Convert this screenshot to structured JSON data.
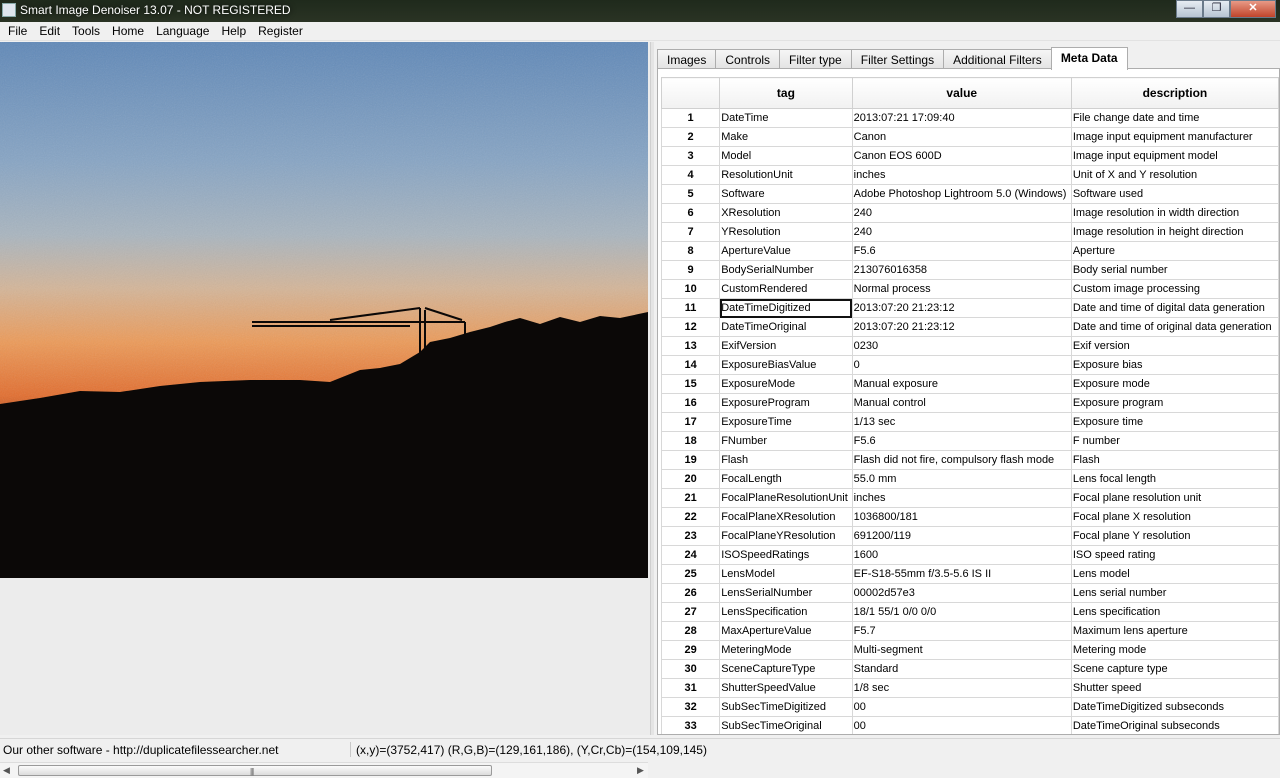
{
  "window": {
    "title": "Smart Image Denoiser 13.07 - NOT REGISTERED",
    "minimize_label": "—",
    "maximize_label": "❐",
    "close_label": "✕"
  },
  "menu": [
    "File",
    "Edit",
    "Tools",
    "Home",
    "Language",
    "Help",
    "Register"
  ],
  "tabs": [
    {
      "label": "Images",
      "active": false
    },
    {
      "label": "Controls",
      "active": false
    },
    {
      "label": "Filter type",
      "active": false
    },
    {
      "label": "Filter Settings",
      "active": false
    },
    {
      "label": "Additional Filters",
      "active": false
    },
    {
      "label": "Meta Data",
      "active": true
    }
  ],
  "table": {
    "headers": [
      "",
      "tag",
      "value",
      "description"
    ],
    "selected_row": 11,
    "rows": [
      {
        "n": "1",
        "tag": "DateTime",
        "value": "2013:07:21 17:09:40",
        "desc": "File change date and time"
      },
      {
        "n": "2",
        "tag": "Make",
        "value": "Canon",
        "desc": "Image input equipment manufacturer"
      },
      {
        "n": "3",
        "tag": "Model",
        "value": "Canon EOS 600D",
        "desc": "Image input equipment model"
      },
      {
        "n": "4",
        "tag": "ResolutionUnit",
        "value": "inches",
        "desc": "Unit of X and Y resolution"
      },
      {
        "n": "5",
        "tag": "Software",
        "value": "Adobe Photoshop Lightroom 5.0 (Windows)",
        "desc": "Software used"
      },
      {
        "n": "6",
        "tag": "XResolution",
        "value": "240",
        "desc": "Image resolution in width direction"
      },
      {
        "n": "7",
        "tag": "YResolution",
        "value": "240",
        "desc": "Image resolution in height direction"
      },
      {
        "n": "8",
        "tag": "ApertureValue",
        "value": "F5.6",
        "desc": "Aperture"
      },
      {
        "n": "9",
        "tag": "BodySerialNumber",
        "value": "213076016358",
        "desc": "Body serial number"
      },
      {
        "n": "10",
        "tag": "CustomRendered",
        "value": "Normal process",
        "desc": "Custom image processing"
      },
      {
        "n": "11",
        "tag": "DateTimeDigitized",
        "value": "2013:07:20 21:23:12",
        "desc": "Date and time of digital data generation"
      },
      {
        "n": "12",
        "tag": "DateTimeOriginal",
        "value": "2013:07:20 21:23:12",
        "desc": "Date and time of original data generation"
      },
      {
        "n": "13",
        "tag": "ExifVersion",
        "value": "0230",
        "desc": "Exif version"
      },
      {
        "n": "14",
        "tag": "ExposureBiasValue",
        "value": "0",
        "desc": "Exposure bias"
      },
      {
        "n": "15",
        "tag": "ExposureMode",
        "value": "Manual exposure",
        "desc": "Exposure mode"
      },
      {
        "n": "16",
        "tag": "ExposureProgram",
        "value": "Manual control",
        "desc": "Exposure program"
      },
      {
        "n": "17",
        "tag": "ExposureTime",
        "value": "1/13 sec",
        "desc": "Exposure time"
      },
      {
        "n": "18",
        "tag": "FNumber",
        "value": "F5.6",
        "desc": "F number"
      },
      {
        "n": "19",
        "tag": "Flash",
        "value": "Flash did not fire, compulsory flash mode",
        "desc": "Flash"
      },
      {
        "n": "20",
        "tag": "FocalLength",
        "value": "55.0 mm",
        "desc": "Lens focal length"
      },
      {
        "n": "21",
        "tag": "FocalPlaneResolutionUnit",
        "value": "inches",
        "desc": "Focal plane resolution unit"
      },
      {
        "n": "22",
        "tag": "FocalPlaneXResolution",
        "value": "1036800/181",
        "desc": "Focal plane X resolution"
      },
      {
        "n": "23",
        "tag": "FocalPlaneYResolution",
        "value": "691200/119",
        "desc": "Focal plane Y resolution"
      },
      {
        "n": "24",
        "tag": "ISOSpeedRatings",
        "value": "1600",
        "desc": "ISO speed rating"
      },
      {
        "n": "25",
        "tag": "LensModel",
        "value": "EF-S18-55mm f/3.5-5.6 IS II",
        "desc": "Lens model"
      },
      {
        "n": "26",
        "tag": "LensSerialNumber",
        "value": "00002d57e3",
        "desc": "Lens serial number"
      },
      {
        "n": "27",
        "tag": "LensSpecification",
        "value": "18/1 55/1 0/0 0/0",
        "desc": "Lens specification"
      },
      {
        "n": "28",
        "tag": "MaxApertureValue",
        "value": "F5.7",
        "desc": "Maximum lens aperture"
      },
      {
        "n": "29",
        "tag": "MeteringMode",
        "value": "Multi-segment",
        "desc": "Metering mode"
      },
      {
        "n": "30",
        "tag": "SceneCaptureType",
        "value": "Standard",
        "desc": "Scene capture type"
      },
      {
        "n": "31",
        "tag": "ShutterSpeedValue",
        "value": "1/8 sec",
        "desc": "Shutter speed"
      },
      {
        "n": "32",
        "tag": "SubSecTimeDigitized",
        "value": "00",
        "desc": "DateTimeDigitized subseconds"
      },
      {
        "n": "33",
        "tag": "SubSecTimeOriginal",
        "value": "00",
        "desc": "DateTimeOriginal subseconds"
      }
    ]
  },
  "status": {
    "left": "Our other software - http://duplicatefilessearcher.net",
    "right": "(x,y)=(3752,417) (R,G,B)=(129,161,186), (Y,Cr,Cb)=(154,109,145)"
  },
  "scrollbar": {
    "left_arrow": "◀",
    "right_arrow": "▶",
    "grip": "|||"
  },
  "colors": {
    "sky_top": "#6f94bd",
    "sky_horizon": "#e8813a",
    "silhouette": "#0a0706",
    "active_tab": "#ffffff"
  }
}
